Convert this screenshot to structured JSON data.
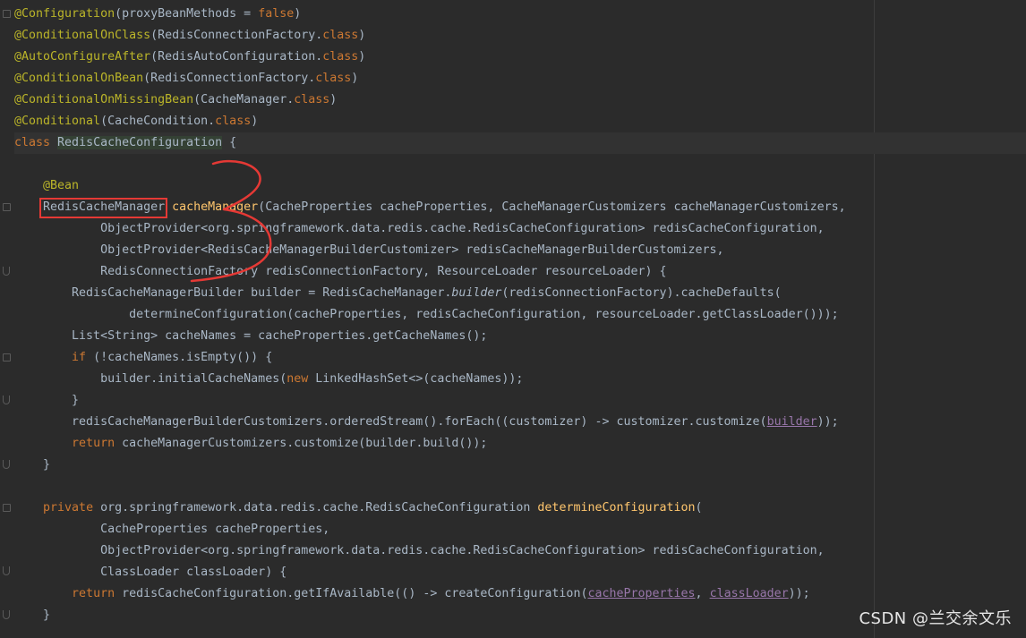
{
  "editor": {
    "colors": {
      "background": "#2b2b2b",
      "plain": "#a9b7c6",
      "annotation": "#bbb529",
      "keyword": "#cc7832",
      "method": "#ffc66d",
      "field": "#9876aa",
      "highlight_box": "#e53935"
    },
    "lines": [
      {
        "id": "l1",
        "tokens": [
          {
            "t": "@Configuration",
            "c": "annotation"
          },
          {
            "t": "(proxyBeanMethods = "
          },
          {
            "t": "false",
            "c": "keyword"
          },
          {
            "t": ")"
          }
        ]
      },
      {
        "id": "l2",
        "tokens": [
          {
            "t": "@ConditionalOnClass",
            "c": "annotation"
          },
          {
            "t": "(RedisConnectionFactory."
          },
          {
            "t": "class",
            "c": "keyword"
          },
          {
            "t": ")"
          }
        ]
      },
      {
        "id": "l3",
        "tokens": [
          {
            "t": "@AutoConfigureAfter",
            "c": "annotation"
          },
          {
            "t": "(RedisAutoConfiguration."
          },
          {
            "t": "class",
            "c": "keyword"
          },
          {
            "t": ")"
          }
        ]
      },
      {
        "id": "l4",
        "tokens": [
          {
            "t": "@ConditionalOnBean",
            "c": "annotation"
          },
          {
            "t": "(RedisConnectionFactory."
          },
          {
            "t": "class",
            "c": "keyword"
          },
          {
            "t": ")"
          }
        ]
      },
      {
        "id": "l5",
        "tokens": [
          {
            "t": "@ConditionalOnMissingBean",
            "c": "annotation"
          },
          {
            "t": "(CacheManager."
          },
          {
            "t": "class",
            "c": "keyword"
          },
          {
            "t": ")"
          }
        ]
      },
      {
        "id": "l6",
        "tokens": [
          {
            "t": "@Conditional",
            "c": "annotation"
          },
          {
            "t": "(CacheCondition."
          },
          {
            "t": "class",
            "c": "keyword"
          },
          {
            "t": ")"
          }
        ]
      },
      {
        "id": "l7",
        "current": true,
        "tokens": [
          {
            "t": "class ",
            "c": "keyword"
          },
          {
            "t": "RedisCacheConfiguration",
            "c": "caret"
          },
          {
            "t": " {"
          }
        ]
      },
      {
        "id": "l8",
        "tokens": []
      },
      {
        "id": "l9",
        "tokens": [
          {
            "t": "    "
          },
          {
            "t": "@Bean",
            "c": "annotation"
          }
        ]
      },
      {
        "id": "l10",
        "tokens": [
          {
            "t": "    RedisCacheManager "
          },
          {
            "t": "cacheManager",
            "c": "method"
          },
          {
            "t": "(CacheProperties cacheProperties, CacheManagerCustomizers cacheManagerCustomizers,"
          }
        ]
      },
      {
        "id": "l11",
        "tokens": [
          {
            "t": "            ObjectProvider<org.springframework.data.redis.cache.RedisCacheConfiguration> redisCacheConfiguration,"
          }
        ]
      },
      {
        "id": "l12",
        "tokens": [
          {
            "t": "            ObjectProvider<RedisCacheManagerBuilderCustomizer> redisCacheManagerBuilderCustomizers,"
          }
        ]
      },
      {
        "id": "l13",
        "tokens": [
          {
            "t": "            RedisConnectionFactory redisConnectionFactory, ResourceLoader resourceLoader) {"
          }
        ]
      },
      {
        "id": "l14",
        "tokens": [
          {
            "t": "        RedisCacheManagerBuilder builder = RedisCacheManager."
          },
          {
            "t": "builder",
            "c": "italic"
          },
          {
            "t": "(redisConnectionFactory).cacheDefaults("
          }
        ]
      },
      {
        "id": "l15",
        "tokens": [
          {
            "t": "                determineConfiguration(cacheProperties, redisCacheConfiguration, resourceLoader.getClassLoader()));"
          }
        ]
      },
      {
        "id": "l16",
        "tokens": [
          {
            "t": "        List<String> cacheNames = cacheProperties.getCacheNames();"
          }
        ]
      },
      {
        "id": "l17",
        "tokens": [
          {
            "t": "        "
          },
          {
            "t": "if",
            "c": "keyword"
          },
          {
            "t": " (!cacheNames.isEmpty()) {"
          }
        ]
      },
      {
        "id": "l18",
        "tokens": [
          {
            "t": "            builder.initialCacheNames("
          },
          {
            "t": "new",
            "c": "keyword"
          },
          {
            "t": " LinkedHashSet<>(cacheNames));"
          }
        ]
      },
      {
        "id": "l19",
        "tokens": [
          {
            "t": "        }"
          }
        ]
      },
      {
        "id": "l20",
        "tokens": [
          {
            "t": "        redisCacheManagerBuilderCustomizers.orderedStream().forEach((customizer) -> customizer.customize("
          },
          {
            "t": "builder",
            "c": "field"
          },
          {
            "t": "));"
          }
        ]
      },
      {
        "id": "l21",
        "tokens": [
          {
            "t": "        "
          },
          {
            "t": "return",
            "c": "keyword"
          },
          {
            "t": " cacheManagerCustomizers.customize(builder.build());"
          }
        ]
      },
      {
        "id": "l22",
        "tokens": [
          {
            "t": "    }"
          }
        ]
      },
      {
        "id": "l23",
        "tokens": []
      },
      {
        "id": "l24",
        "tokens": [
          {
            "t": "    "
          },
          {
            "t": "private",
            "c": "keyword"
          },
          {
            "t": " org.springframework.data.redis.cache.RedisCacheConfiguration "
          },
          {
            "t": "determineConfiguration",
            "c": "method"
          },
          {
            "t": "("
          }
        ]
      },
      {
        "id": "l25",
        "tokens": [
          {
            "t": "            CacheProperties cacheProperties,"
          }
        ]
      },
      {
        "id": "l26",
        "tokens": [
          {
            "t": "            ObjectProvider<org.springframework.data.redis.cache.RedisCacheConfiguration> redisCacheConfiguration,"
          }
        ]
      },
      {
        "id": "l27",
        "tokens": [
          {
            "t": "            ClassLoader classLoader) {"
          }
        ]
      },
      {
        "id": "l28",
        "tokens": [
          {
            "t": "        "
          },
          {
            "t": "return",
            "c": "keyword"
          },
          {
            "t": " redisCacheConfiguration.getIfAvailable(() -> createConfiguration("
          },
          {
            "t": "cacheProperties",
            "c": "field"
          },
          {
            "t": ", "
          },
          {
            "t": "classLoader",
            "c": "field"
          },
          {
            "t": "));"
          }
        ]
      },
      {
        "id": "l29",
        "tokens": [
          {
            "t": "    }"
          }
        ]
      }
    ]
  },
  "watermark": {
    "text": "CSDN @兰交余文乐"
  }
}
